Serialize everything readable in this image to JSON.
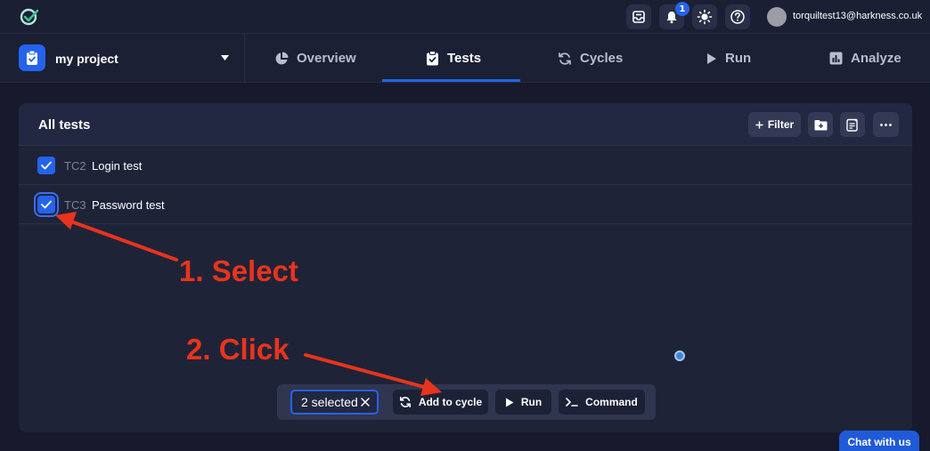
{
  "topbar": {
    "notification_count": "1",
    "user_email": "torquiltest13@harkness.co.uk"
  },
  "project": {
    "name": "my project"
  },
  "tabs": [
    {
      "label": "Overview",
      "icon": "pie-chart-icon"
    },
    {
      "label": "Tests",
      "icon": "clipboard-check-icon",
      "active": true
    },
    {
      "label": "Cycles",
      "icon": "refresh-icon"
    },
    {
      "label": "Run",
      "icon": "play-icon"
    },
    {
      "label": "Analyze",
      "icon": "bar-chart-icon"
    }
  ],
  "tests_panel": {
    "title": "All tests",
    "filter_label": "Filter",
    "rows": [
      {
        "id": "TC2",
        "name": "Login test",
        "checked": true
      },
      {
        "id": "TC3",
        "name": "Password test",
        "checked": true
      }
    ]
  },
  "action_bar": {
    "selected_label": "2 selected",
    "add_to_cycle_label": "Add to cycle",
    "run_label": "Run",
    "command_label": "Command"
  },
  "annotations": {
    "step1": "1. Select",
    "step2": "2. Click"
  },
  "chat": {
    "label": "Chat with us"
  },
  "colors": {
    "accent": "#2563eb",
    "annotation": "#e8341c",
    "background": "#171a2c"
  }
}
